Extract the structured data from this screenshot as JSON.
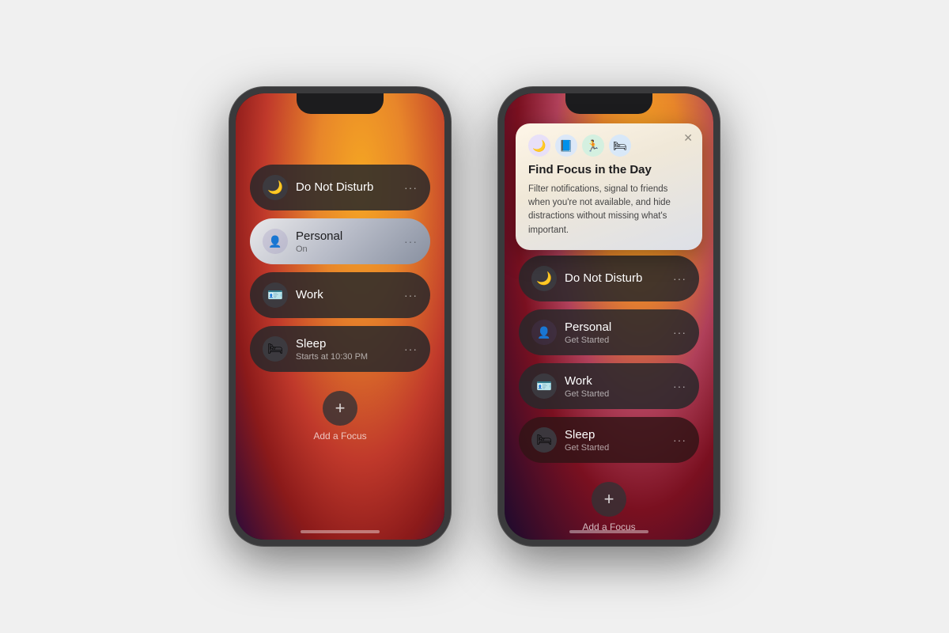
{
  "page": {
    "background": "#f0f0f0"
  },
  "phone1": {
    "focus_items": [
      {
        "id": "dnd",
        "name": "Do Not Disturb",
        "subtitle": "",
        "style": "dark",
        "icon": "🌙"
      },
      {
        "id": "personal",
        "name": "Personal",
        "subtitle": "On",
        "style": "active-personal",
        "icon": "👤"
      },
      {
        "id": "work",
        "name": "Work",
        "subtitle": "",
        "style": "dark",
        "icon": "🪪"
      },
      {
        "id": "sleep",
        "name": "Sleep",
        "subtitle": "Starts at 10:30 PM",
        "style": "dark",
        "icon": "🛏"
      }
    ],
    "add_label": "Add a Focus"
  },
  "phone2": {
    "popup": {
      "title": "Find Focus in the Day",
      "description": "Filter notifications, signal to friends when you're not available, and hide distractions without missing what's important.",
      "icons": [
        "🌙",
        "📘",
        "🏃",
        "🛏"
      ],
      "icon_colors": [
        "#5856d6",
        "#1a6fbd",
        "#2d9244",
        "#4a6fa5"
      ],
      "close_label": "✕"
    },
    "focus_items": [
      {
        "id": "dnd",
        "name": "Do Not Disturb",
        "subtitle": "",
        "style": "dark",
        "icon": "🌙"
      },
      {
        "id": "personal",
        "name": "Personal",
        "subtitle": "Get Started",
        "style": "dark",
        "icon": "👤"
      },
      {
        "id": "work",
        "name": "Work",
        "subtitle": "Get Started",
        "style": "dark",
        "icon": "🪪"
      },
      {
        "id": "sleep",
        "name": "Sleep",
        "subtitle": "Get Started",
        "style": "sleep-dark",
        "icon": "🛏"
      }
    ],
    "add_label": "Add a Focus"
  }
}
